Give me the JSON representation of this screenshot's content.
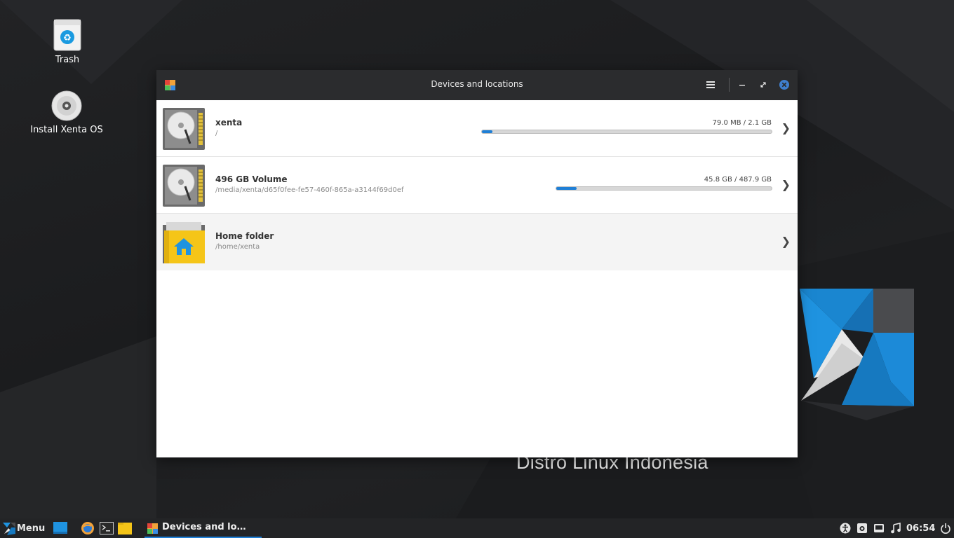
{
  "desktop": {
    "icons": [
      {
        "label": "Trash"
      },
      {
        "label": "Install Xenta OS"
      }
    ],
    "tagline": "Distro Linux Indonesia"
  },
  "window": {
    "title": "Devices and locations",
    "items": [
      {
        "name": "xenta",
        "path": "/",
        "usage": "79.0 MB / 2.1 GB",
        "used_fraction": 0.037,
        "icon": "hard-drive-icon"
      },
      {
        "name": "496 GB Volume",
        "path": "/media/xenta/d65f0fee-fe57-460f-865a-a3144f69d0ef",
        "usage": "45.8 GB / 487.9 GB",
        "used_fraction": 0.094,
        "icon": "hard-drive-icon"
      },
      {
        "name": "Home folder",
        "path": "/home/xenta",
        "icon": "home-folder-icon"
      }
    ]
  },
  "taskbar": {
    "menu_label": "Menu",
    "active_task": "Devices and lo…",
    "clock": "06:54"
  },
  "colors": {
    "accent": "#1f7fd6",
    "titlebar": "#2b2c2e",
    "taskbar": "#232426",
    "folder_yellow": "#f5c518"
  }
}
